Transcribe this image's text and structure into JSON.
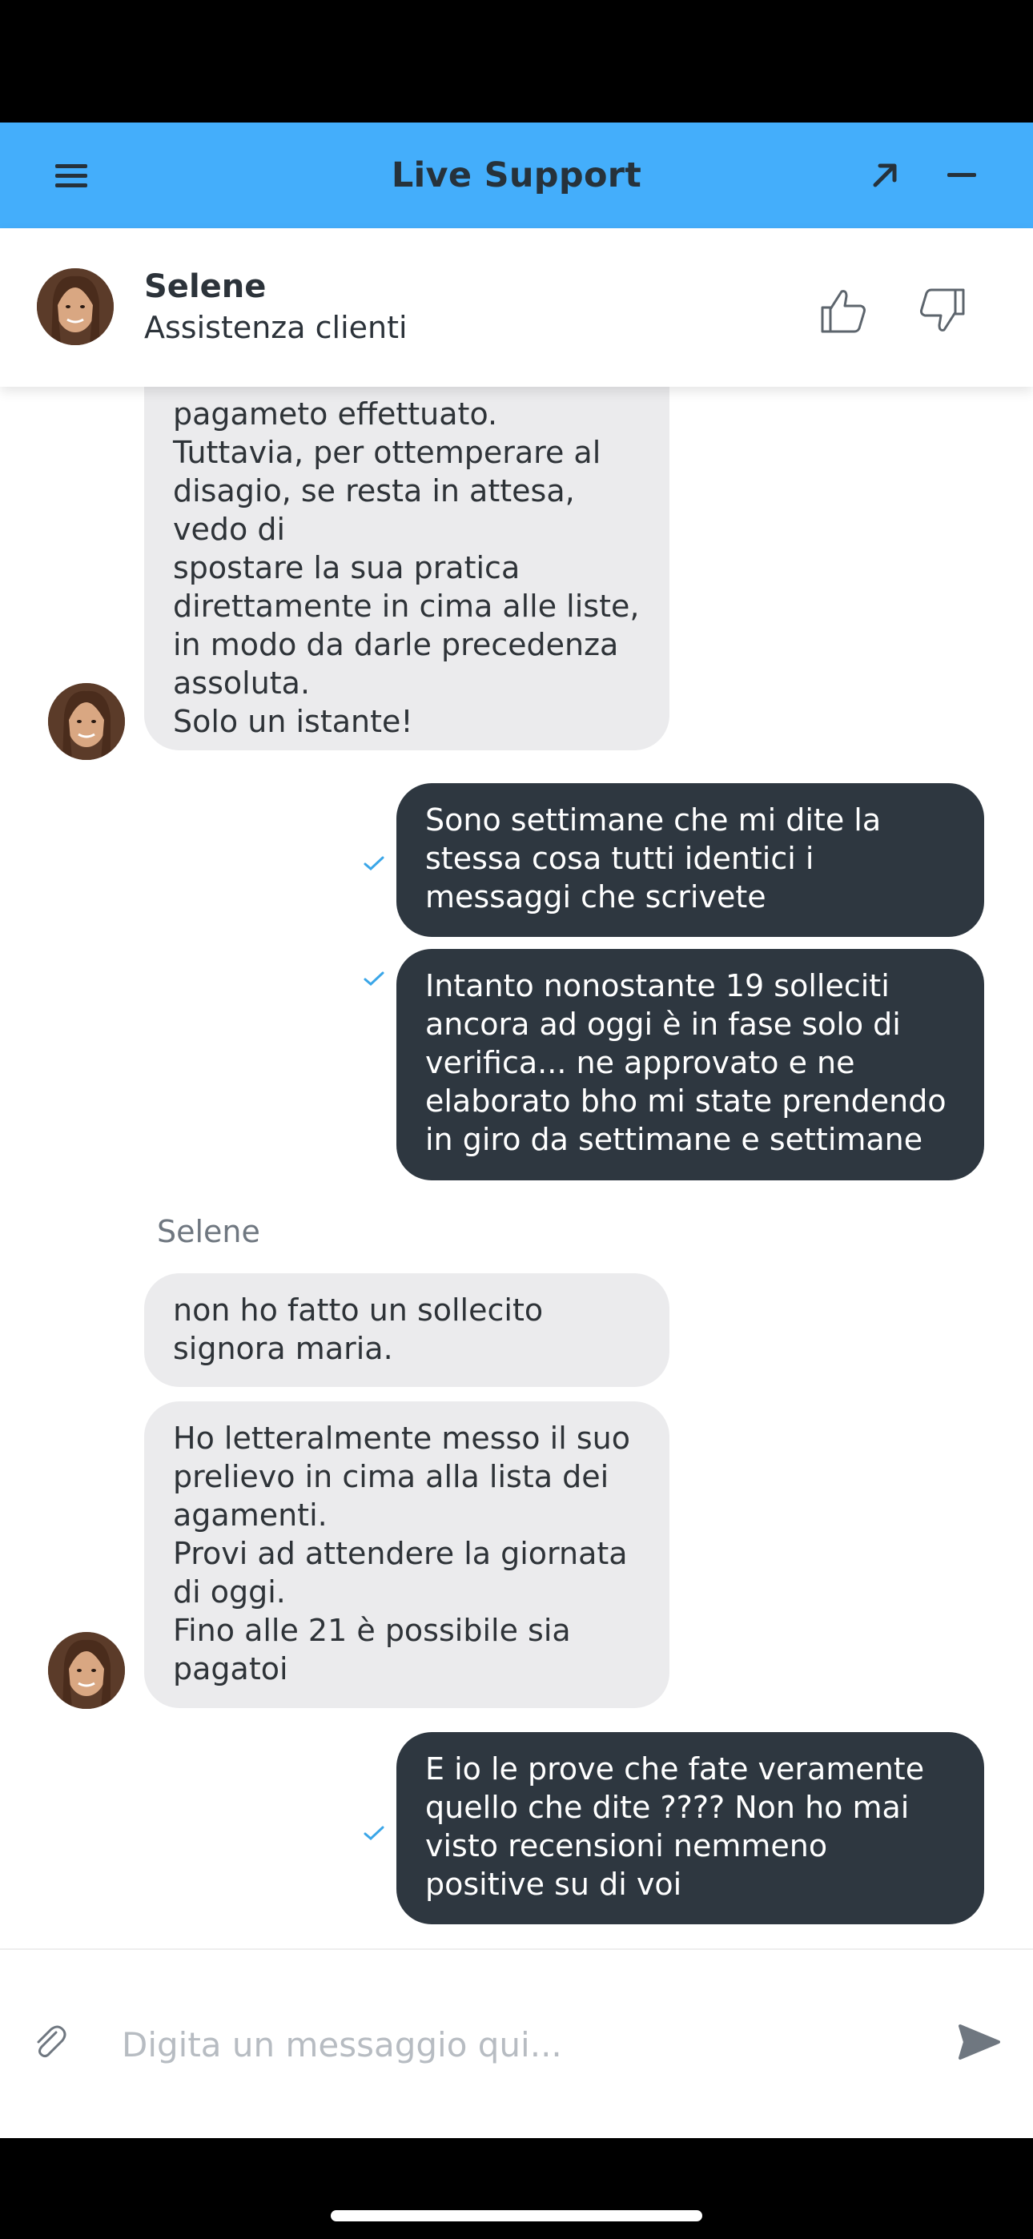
{
  "header": {
    "title": "Live Support",
    "background": "#44aefb"
  },
  "agent": {
    "name": "Selene",
    "role": "Assistenza clienti"
  },
  "messages": [
    {
      "from": "agent",
      "text": "pagameto effettuato.\nTuttavia, per ottemperare al disagio, se resta in attesa, vedo di\nspostare la sua pratica direttamente in cima alle liste, in modo da darle precedenza assoluta.\nSolo un istante!"
    },
    {
      "from": "user",
      "text": "Sono settimane che mi dite la stessa cosa tutti identici i messaggi che scrivete",
      "status": "sent"
    },
    {
      "from": "user",
      "text": "Intanto nonostante 19 solleciti ancora ad oggi è in fase solo di verifica... ne approvato e ne elaborato bho mi state prendendo in giro da settimane e settimane",
      "status": "sent"
    },
    {
      "from": "agent",
      "sender": "Selene",
      "text": "non ho fatto un sollecito signora maria."
    },
    {
      "from": "agent",
      "text": "Ho letteralmente messo il suo prelievo in cima alla lista dei agamenti.\nProvi ad attendere la giornata di oggi.\nFino alle 21 è possibile sia pagatoi"
    },
    {
      "from": "user",
      "text": "E io le prove che fate veramente quello che dite ???? Non ho mai visto recensioni nemmeno positive su di voi",
      "status": "sent"
    }
  ],
  "composer": {
    "placeholder": "Digita un messaggio qui..."
  },
  "colors": {
    "agent_bubble": "#ebebed",
    "user_bubble": "#2e3740",
    "check": "#3aa6e8"
  }
}
